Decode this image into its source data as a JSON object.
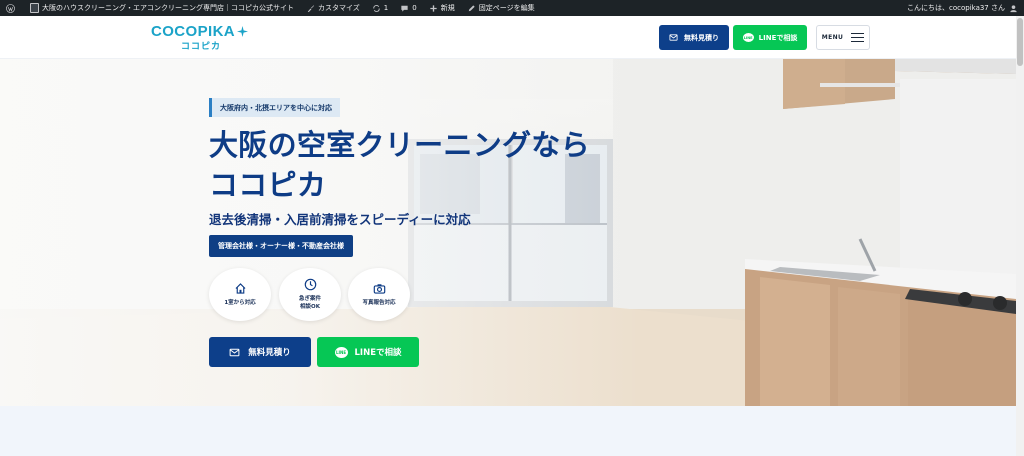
{
  "admin_bar": {
    "site_name": "大阪のハウスクリーニング・エアコンクリーニング専門店｜ココピカ公式サイト",
    "customize": "カスタマイズ",
    "updates_count": "1",
    "comments_count": "0",
    "new": "新規",
    "edit_page": "固定ページを編集",
    "greeting": "こんにちは、cocopika37 さん"
  },
  "header": {
    "logo_main": "COCOPIKA",
    "logo_sub": "ココピカ",
    "estimate_label": "無料見積り",
    "line_label": "LINEで相談",
    "menu_label": "MENU"
  },
  "hero": {
    "area_tag": "大阪府内・北摂エリアを中心に対応",
    "headline_line1": "大阪の空室クリーニングなら",
    "headline_line2": "ココピカ",
    "subline": "退去後清掃・入居前清掃をスピーディーに対応",
    "clients": "管理会社様・オーナー様・不動産会社様",
    "features": [
      {
        "icon": "home-icon",
        "line1": "1室から対応",
        "line2": ""
      },
      {
        "icon": "clock-icon",
        "line1": "急ぎ案件",
        "line2": "相談OK"
      },
      {
        "icon": "camera-icon",
        "line1": "写真報告対応",
        "line2": ""
      }
    ],
    "cta_estimate": "無料見積り",
    "cta_line": "LINEで相談"
  },
  "colors": {
    "primary_navy": "#0d3f8a",
    "line_green": "#06c755",
    "logo_cyan": "#1ba3c8",
    "admin_bar": "#1d2327"
  }
}
